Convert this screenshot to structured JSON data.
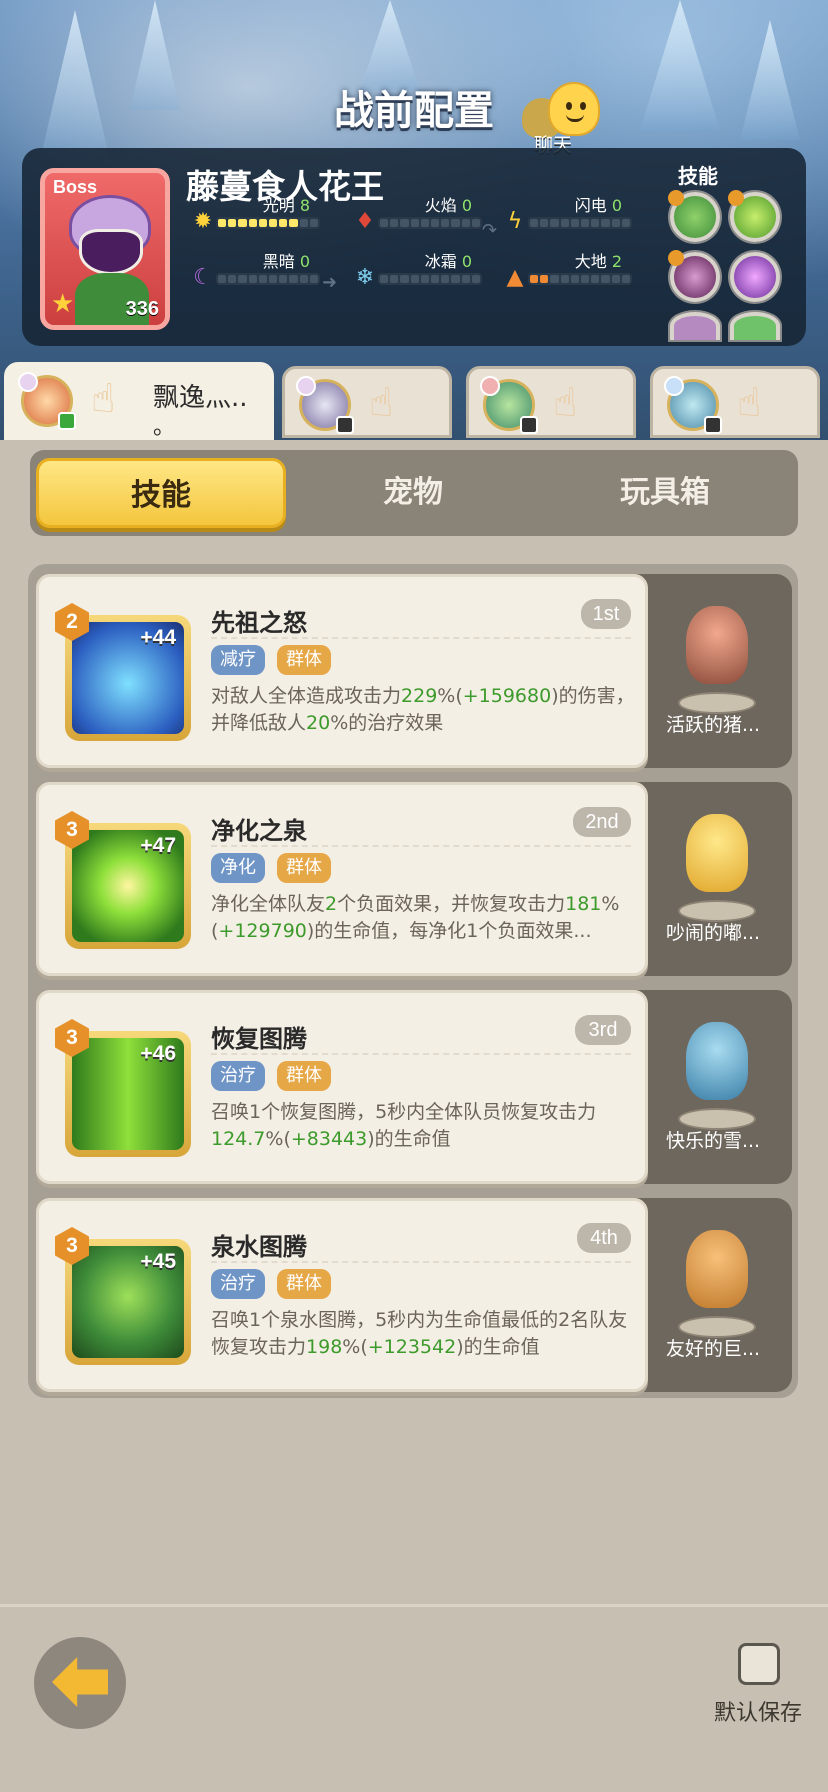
{
  "header": {
    "title": "战前配置",
    "chat_label": "聊天"
  },
  "boss": {
    "tag": "Boss",
    "name": "藤蔓食人花王",
    "level": "336",
    "skills_title": "技能",
    "elements": [
      {
        "name": "光明",
        "value": "8",
        "fill": 8,
        "icon": "sun-icon",
        "color": "#ffe86a"
      },
      {
        "name": "火焰",
        "value": "0",
        "fill": 0,
        "icon": "fire-icon",
        "color": "#e0493a"
      },
      {
        "name": "闪电",
        "value": "0",
        "fill": 0,
        "icon": "lightning-icon",
        "color": "#ffd23c"
      },
      {
        "name": "黑暗",
        "value": "0",
        "fill": 0,
        "icon": "moon-icon",
        "color": "#b86ae0"
      },
      {
        "name": "冰霜",
        "value": "0",
        "fill": 0,
        "icon": "snowflake-icon",
        "color": "#7fd0f0"
      },
      {
        "name": "大地",
        "value": "2",
        "fill": 2,
        "icon": "mountain-icon",
        "color": "#f08a34"
      }
    ]
  },
  "team": [
    {
      "name": "飘逸灬...",
      "dot": "。"
    }
  ],
  "segments": {
    "skills": "技能",
    "pets": "宠物",
    "toybox": "玩具箱"
  },
  "skills": [
    {
      "level": "2",
      "plus": "+44",
      "title": "先祖之怒",
      "rank": "1st",
      "tags": [
        "减疗",
        "群体"
      ],
      "desc_parts": [
        "对敌人全体造成攻击力",
        "229",
        "%(",
        "+159680",
        ")的伤害，并降低敌人",
        "20",
        "%的治疗效果"
      ],
      "pet_name": "活跃的猪..."
    },
    {
      "level": "3",
      "plus": "+47",
      "title": "净化之泉",
      "rank": "2nd",
      "tags": [
        "净化",
        "群体"
      ],
      "desc_parts": [
        "净化全体队友",
        "2",
        "个负面效果，并恢复攻击力",
        "181",
        "%(",
        "+129790",
        ")的生命值，每净化1个负面效果..."
      ],
      "pet_name": "吵闹的嘟..."
    },
    {
      "level": "3",
      "plus": "+46",
      "title": "恢复图腾",
      "rank": "3rd",
      "tags": [
        "治疗",
        "群体"
      ],
      "desc_parts": [
        "召唤1个恢复图腾，5秒内全体队员恢复攻击力",
        "124.7",
        "%(",
        "+83443",
        ")的生命值"
      ],
      "pet_name": "快乐的雪..."
    },
    {
      "level": "3",
      "plus": "+45",
      "title": "泉水图腾",
      "rank": "4th",
      "tags": [
        "治疗",
        "群体"
      ],
      "desc_parts": [
        "召唤1个泉水图腾，5秒内为生命值最低的2名队友恢复攻击力",
        "198",
        "%(",
        "+123542",
        ")的生命值"
      ],
      "pet_name": "友好的巨..."
    }
  ],
  "footer": {
    "save_label": "默认保存"
  }
}
